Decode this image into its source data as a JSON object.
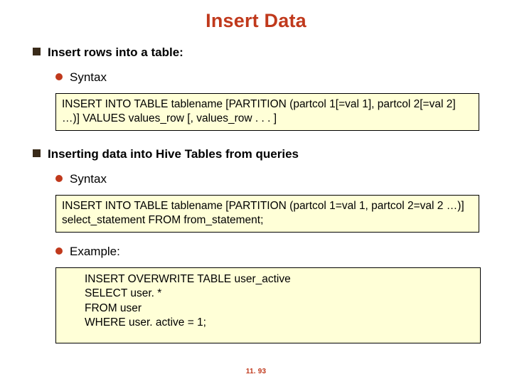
{
  "title": "Insert Data",
  "sections": [
    {
      "heading": "Insert rows into a table:",
      "items": [
        {
          "label": "Syntax",
          "box": "INSERT INTO TABLE tablename [PARTITION (partcol 1[=val 1], partcol 2[=val 2] …)] VALUES values_row [, values_row . . . ]"
        }
      ]
    },
    {
      "heading": "Inserting data into Hive Tables from queries",
      "items": [
        {
          "label": "Syntax",
          "box": "INSERT INTO TABLE tablename [PARTITION (partcol 1=val 1, partcol 2=val 2 …)] select_statement FROM from_statement;"
        },
        {
          "label": "Example:",
          "box": "INSERT OVERWRITE TABLE user_active\nSELECT user. *\nFROM user\nWHERE user. active = 1;",
          "tall": true
        }
      ]
    }
  ],
  "footer": "11. 93"
}
